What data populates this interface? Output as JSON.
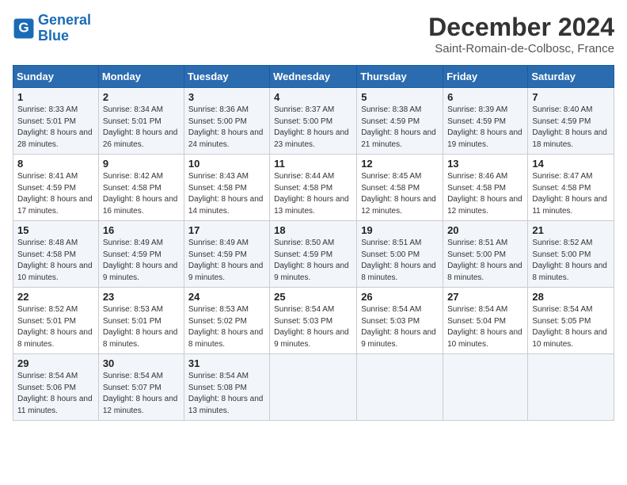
{
  "logo": {
    "line1": "General",
    "line2": "Blue"
  },
  "title": "December 2024",
  "subtitle": "Saint-Romain-de-Colbosc, France",
  "days_of_week": [
    "Sunday",
    "Monday",
    "Tuesday",
    "Wednesday",
    "Thursday",
    "Friday",
    "Saturday"
  ],
  "weeks": [
    [
      {
        "day": 1,
        "sunrise": "Sunrise: 8:33 AM",
        "sunset": "Sunset: 5:01 PM",
        "daylight": "Daylight: 8 hours and 28 minutes."
      },
      {
        "day": 2,
        "sunrise": "Sunrise: 8:34 AM",
        "sunset": "Sunset: 5:01 PM",
        "daylight": "Daylight: 8 hours and 26 minutes."
      },
      {
        "day": 3,
        "sunrise": "Sunrise: 8:36 AM",
        "sunset": "Sunset: 5:00 PM",
        "daylight": "Daylight: 8 hours and 24 minutes."
      },
      {
        "day": 4,
        "sunrise": "Sunrise: 8:37 AM",
        "sunset": "Sunset: 5:00 PM",
        "daylight": "Daylight: 8 hours and 23 minutes."
      },
      {
        "day": 5,
        "sunrise": "Sunrise: 8:38 AM",
        "sunset": "Sunset: 4:59 PM",
        "daylight": "Daylight: 8 hours and 21 minutes."
      },
      {
        "day": 6,
        "sunrise": "Sunrise: 8:39 AM",
        "sunset": "Sunset: 4:59 PM",
        "daylight": "Daylight: 8 hours and 19 minutes."
      },
      {
        "day": 7,
        "sunrise": "Sunrise: 8:40 AM",
        "sunset": "Sunset: 4:59 PM",
        "daylight": "Daylight: 8 hours and 18 minutes."
      }
    ],
    [
      {
        "day": 8,
        "sunrise": "Sunrise: 8:41 AM",
        "sunset": "Sunset: 4:59 PM",
        "daylight": "Daylight: 8 hours and 17 minutes."
      },
      {
        "day": 9,
        "sunrise": "Sunrise: 8:42 AM",
        "sunset": "Sunset: 4:58 PM",
        "daylight": "Daylight: 8 hours and 16 minutes."
      },
      {
        "day": 10,
        "sunrise": "Sunrise: 8:43 AM",
        "sunset": "Sunset: 4:58 PM",
        "daylight": "Daylight: 8 hours and 14 minutes."
      },
      {
        "day": 11,
        "sunrise": "Sunrise: 8:44 AM",
        "sunset": "Sunset: 4:58 PM",
        "daylight": "Daylight: 8 hours and 13 minutes."
      },
      {
        "day": 12,
        "sunrise": "Sunrise: 8:45 AM",
        "sunset": "Sunset: 4:58 PM",
        "daylight": "Daylight: 8 hours and 12 minutes."
      },
      {
        "day": 13,
        "sunrise": "Sunrise: 8:46 AM",
        "sunset": "Sunset: 4:58 PM",
        "daylight": "Daylight: 8 hours and 12 minutes."
      },
      {
        "day": 14,
        "sunrise": "Sunrise: 8:47 AM",
        "sunset": "Sunset: 4:58 PM",
        "daylight": "Daylight: 8 hours and 11 minutes."
      }
    ],
    [
      {
        "day": 15,
        "sunrise": "Sunrise: 8:48 AM",
        "sunset": "Sunset: 4:58 PM",
        "daylight": "Daylight: 8 hours and 10 minutes."
      },
      {
        "day": 16,
        "sunrise": "Sunrise: 8:49 AM",
        "sunset": "Sunset: 4:59 PM",
        "daylight": "Daylight: 8 hours and 9 minutes."
      },
      {
        "day": 17,
        "sunrise": "Sunrise: 8:49 AM",
        "sunset": "Sunset: 4:59 PM",
        "daylight": "Daylight: 8 hours and 9 minutes."
      },
      {
        "day": 18,
        "sunrise": "Sunrise: 8:50 AM",
        "sunset": "Sunset: 4:59 PM",
        "daylight": "Daylight: 8 hours and 9 minutes."
      },
      {
        "day": 19,
        "sunrise": "Sunrise: 8:51 AM",
        "sunset": "Sunset: 5:00 PM",
        "daylight": "Daylight: 8 hours and 8 minutes."
      },
      {
        "day": 20,
        "sunrise": "Sunrise: 8:51 AM",
        "sunset": "Sunset: 5:00 PM",
        "daylight": "Daylight: 8 hours and 8 minutes."
      },
      {
        "day": 21,
        "sunrise": "Sunrise: 8:52 AM",
        "sunset": "Sunset: 5:00 PM",
        "daylight": "Daylight: 8 hours and 8 minutes."
      }
    ],
    [
      {
        "day": 22,
        "sunrise": "Sunrise: 8:52 AM",
        "sunset": "Sunset: 5:01 PM",
        "daylight": "Daylight: 8 hours and 8 minutes."
      },
      {
        "day": 23,
        "sunrise": "Sunrise: 8:53 AM",
        "sunset": "Sunset: 5:01 PM",
        "daylight": "Daylight: 8 hours and 8 minutes."
      },
      {
        "day": 24,
        "sunrise": "Sunrise: 8:53 AM",
        "sunset": "Sunset: 5:02 PM",
        "daylight": "Daylight: 8 hours and 8 minutes."
      },
      {
        "day": 25,
        "sunrise": "Sunrise: 8:54 AM",
        "sunset": "Sunset: 5:03 PM",
        "daylight": "Daylight: 8 hours and 9 minutes."
      },
      {
        "day": 26,
        "sunrise": "Sunrise: 8:54 AM",
        "sunset": "Sunset: 5:03 PM",
        "daylight": "Daylight: 8 hours and 9 minutes."
      },
      {
        "day": 27,
        "sunrise": "Sunrise: 8:54 AM",
        "sunset": "Sunset: 5:04 PM",
        "daylight": "Daylight: 8 hours and 10 minutes."
      },
      {
        "day": 28,
        "sunrise": "Sunrise: 8:54 AM",
        "sunset": "Sunset: 5:05 PM",
        "daylight": "Daylight: 8 hours and 10 minutes."
      }
    ],
    [
      {
        "day": 29,
        "sunrise": "Sunrise: 8:54 AM",
        "sunset": "Sunset: 5:06 PM",
        "daylight": "Daylight: 8 hours and 11 minutes."
      },
      {
        "day": 30,
        "sunrise": "Sunrise: 8:54 AM",
        "sunset": "Sunset: 5:07 PM",
        "daylight": "Daylight: 8 hours and 12 minutes."
      },
      {
        "day": 31,
        "sunrise": "Sunrise: 8:54 AM",
        "sunset": "Sunset: 5:08 PM",
        "daylight": "Daylight: 8 hours and 13 minutes."
      },
      null,
      null,
      null,
      null
    ]
  ]
}
